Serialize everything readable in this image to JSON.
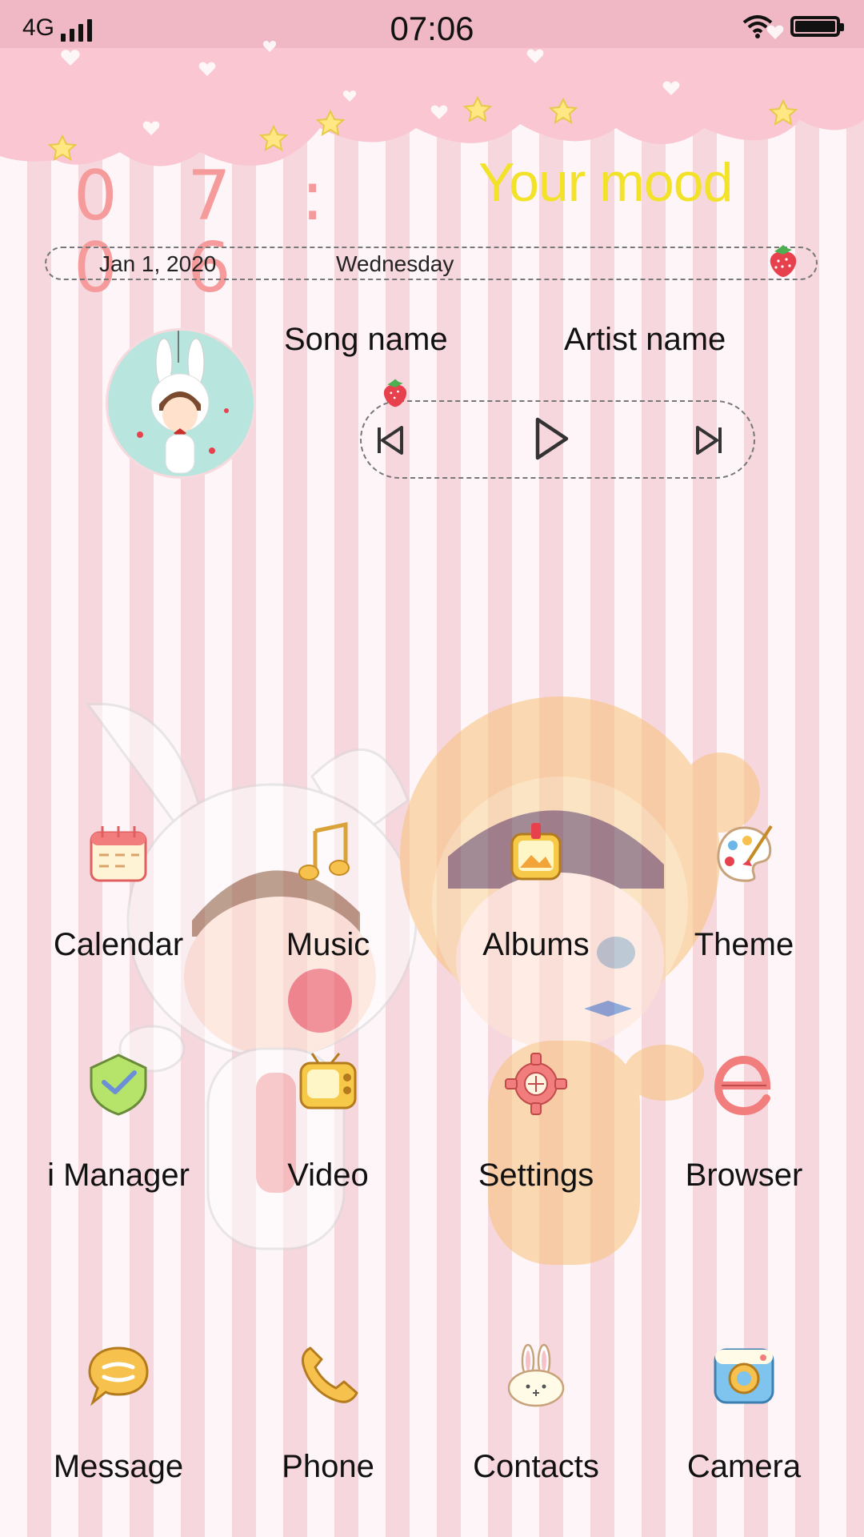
{
  "status_bar": {
    "network": "4G",
    "time": "07:06",
    "wifi_icon": "wifi-icon",
    "battery_icon": "battery-icon"
  },
  "widget": {
    "clock": "0 7 : 0 6",
    "mood": "Your mood",
    "date": "Jan 1, 2020",
    "weekday": "Wednesday",
    "song": "Song name",
    "artist": "Artist name"
  },
  "colors": {
    "clock": "#f59b9b",
    "mood": "#f2e22a",
    "stripe_light": "#fdf5f8",
    "stripe_pink": "#f6d7de",
    "cloud": "#f9c6d2"
  },
  "apps": [
    {
      "label": "Calendar",
      "icon": "calendar-icon"
    },
    {
      "label": "Music",
      "icon": "music-icon"
    },
    {
      "label": "Albums",
      "icon": "albums-icon"
    },
    {
      "label": "Theme",
      "icon": "palette-icon"
    },
    {
      "label": "i Manager",
      "icon": "shield-check-icon"
    },
    {
      "label": "Video",
      "icon": "tv-icon"
    },
    {
      "label": "Settings",
      "icon": "gear-icon"
    },
    {
      "label": "Browser",
      "icon": "browser-e-icon"
    }
  ],
  "dock": [
    {
      "label": "Message",
      "icon": "message-bubble-icon"
    },
    {
      "label": "Phone",
      "icon": "phone-icon"
    },
    {
      "label": "Contacts",
      "icon": "bunny-icon"
    },
    {
      "label": "Camera",
      "icon": "camera-icon"
    }
  ]
}
